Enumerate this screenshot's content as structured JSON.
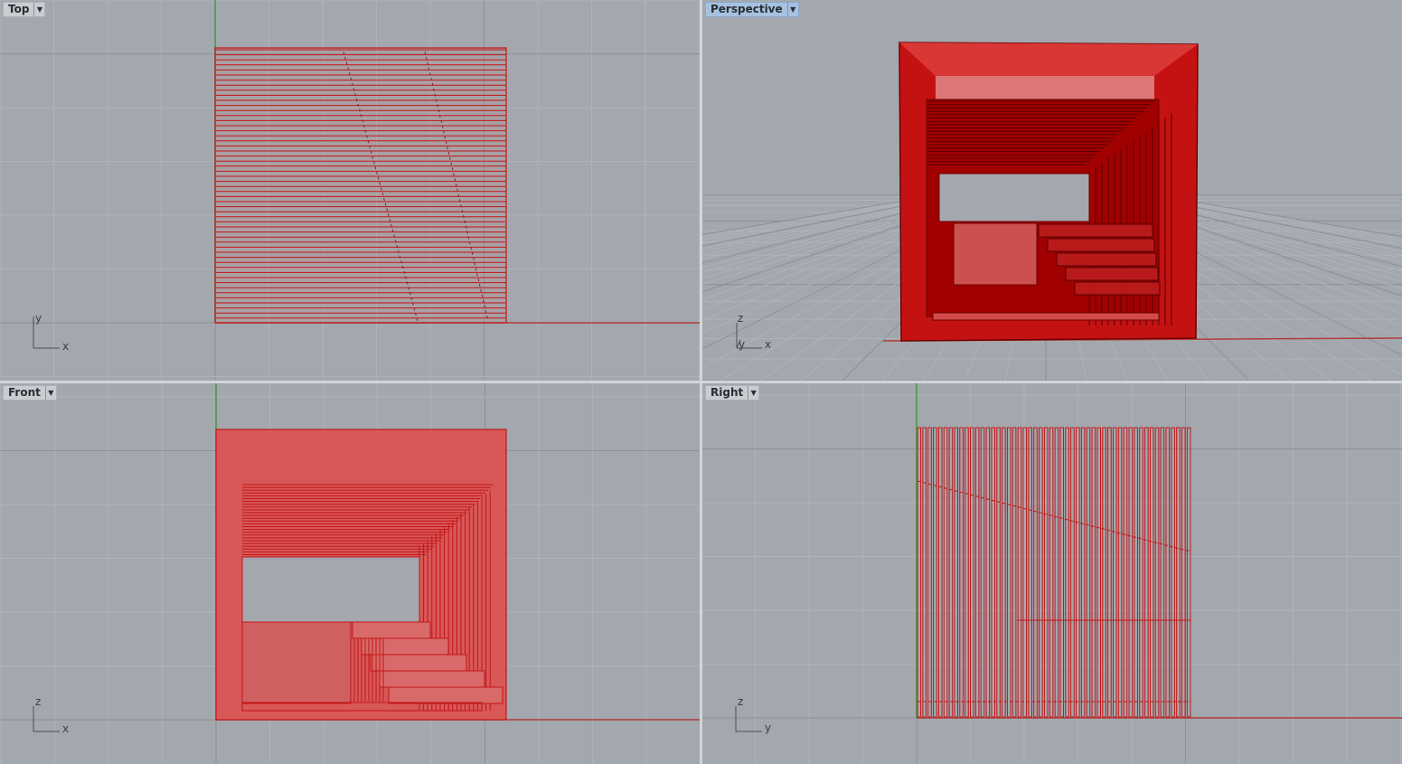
{
  "viewports": {
    "top": {
      "label": "Top",
      "axis_h": "x",
      "axis_v": "y"
    },
    "perspective": {
      "label": "Perspective",
      "axis_h": "x",
      "axis_v": "z",
      "axis_d": "y"
    },
    "front": {
      "label": "Front",
      "axis_h": "x",
      "axis_v": "z"
    },
    "right": {
      "label": "Right",
      "axis_h": "y",
      "axis_v": "z"
    }
  },
  "colors": {
    "viewport_bg": "#a3a8ae",
    "grid_minor": "#afb3b9",
    "grid_major": "#8d9197",
    "x_axis": "#b23b3b",
    "y_axis": "#3f9a3f",
    "object": "#c41515",
    "object_fill": "#d85858",
    "active_tab": "#a6c2e0"
  },
  "icons": {
    "dropdown": "chevron-down-icon"
  }
}
